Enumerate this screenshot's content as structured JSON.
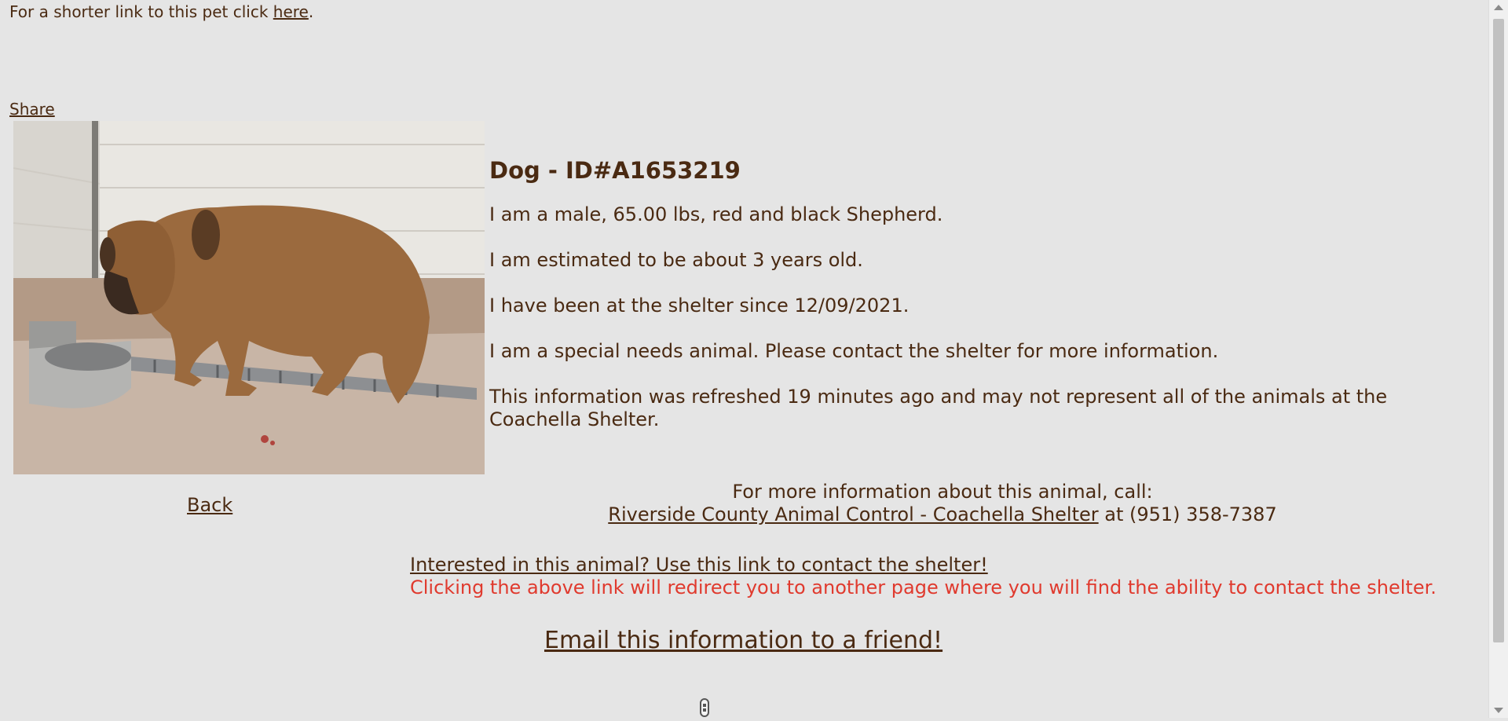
{
  "header": {
    "short_link_prefix": "For a shorter link to this pet click",
    "short_link_text": "here",
    "short_link_suffix": ".",
    "share_label": "Share"
  },
  "animal": {
    "title": "Dog - ID#A1653219",
    "description": "I am a male, 65.00 lbs, red and black Shepherd.",
    "age": "I am estimated to be about 3 years old.",
    "shelter_since": "I have been at the shelter since 12/09/2021.",
    "special_needs": "I am a special needs animal. Please contact the shelter for more information.",
    "refresh_note": "This information was refreshed 19 minutes ago and may not represent all of the animals at the Coachella Shelter."
  },
  "nav": {
    "back_label": "Back"
  },
  "contact": {
    "call_text": "For more information about this animal, call:",
    "shelter_link": "Riverside County Animal Control - Coachella Shelter",
    "phone_text": "at (951) 358-7387"
  },
  "interest": {
    "link_text": "Interested in this animal? Use this link to contact the shelter!",
    "warning": "Clicking the above link will redirect you to another page where you will find the ability to contact the shelter."
  },
  "email": {
    "link_text": "Email this information to a friend!"
  },
  "colors": {
    "text": "#4a2a12",
    "warning": "#e03a2e",
    "background": "#e5e5e5"
  }
}
